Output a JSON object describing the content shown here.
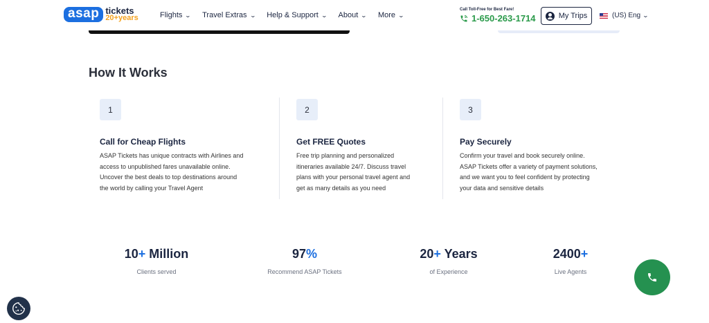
{
  "header": {
    "logo": {
      "brand": "asap",
      "tickets": "tickets",
      "years": "20+years"
    },
    "nav": [
      {
        "label": "Flights"
      },
      {
        "label": "Travel Extras"
      },
      {
        "label": "Help & Support"
      },
      {
        "label": "About"
      },
      {
        "label": "More"
      }
    ],
    "tollfree_label": "Call Toll-Free for Best Fare!",
    "phone": "1-650-263-1714",
    "my_trips": "My Trips",
    "language": "(US) Eng"
  },
  "how_it_works": {
    "title": "How It Works",
    "steps": [
      {
        "number": "1",
        "title": "Call for Cheap Flights",
        "lines": [
          "ASAP Tickets has unique contracts with Airlines and",
          "access to unpublished fares unavailable online.",
          "Uncover the best deals to top destinations around",
          "the world by calling your Travel Agent"
        ]
      },
      {
        "number": "2",
        "title": "Get FREE Quotes",
        "lines": [
          "Free trip planning and personalized",
          "itineraries available 24/7. Discuss travel",
          "plans with your personal travel agent and",
          "get as many details as you need"
        ]
      },
      {
        "number": "3",
        "title": "Pay Securely",
        "lines": [
          "Confirm your travel and book securely online.",
          "ASAP Tickets offer a variety of payment solutions,",
          "and we want you to feel confident by protecting",
          "your data and sensitive details"
        ]
      }
    ]
  },
  "stats": [
    {
      "value": "10",
      "accent": "+",
      "suffix": " Million",
      "label": "Clients served"
    },
    {
      "value": "97",
      "accent": "%",
      "suffix": "",
      "label": "Recommend ASAP Tickets"
    },
    {
      "value": "20",
      "accent": "+",
      "suffix": " Years",
      "label": "of Experience"
    },
    {
      "value": "2400",
      "accent": "+",
      "suffix": "",
      "label": "Live Agents"
    }
  ],
  "colors": {
    "brand_blue": "#1c6fe0",
    "phone_green": "#2a9a4a",
    "fab_green": "#259150",
    "logo_orange": "#f4a21f"
  },
  "icons": [
    "phone-icon",
    "user-icon",
    "us-flag-icon",
    "chevron-down-icon",
    "cookie-icon"
  ]
}
